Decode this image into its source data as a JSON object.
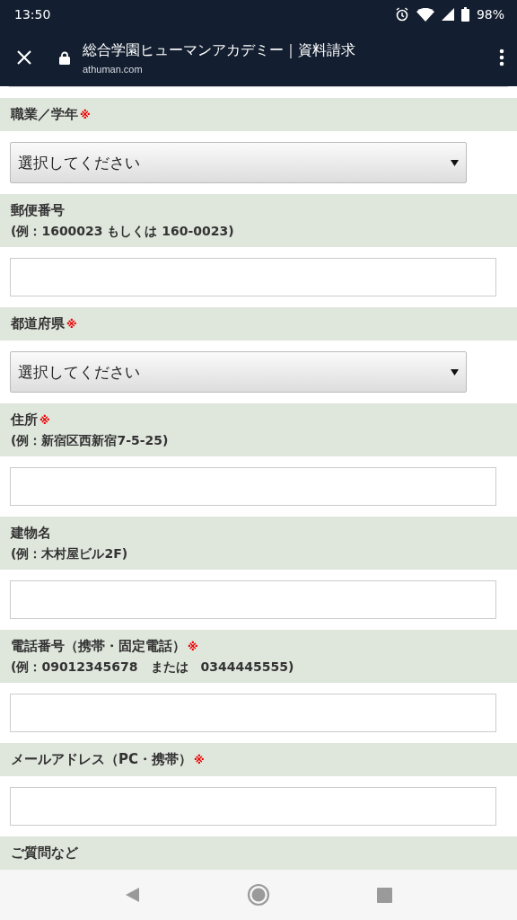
{
  "status_bar": {
    "time": "13:50",
    "battery": "98%"
  },
  "toolbar": {
    "title": "総合学園ヒューマンアカデミー｜資料請求",
    "url": "athuman.com"
  },
  "fields": [
    {
      "label": "職業／学年",
      "required_mark": "※",
      "kind": "select",
      "value": "選択してください"
    },
    {
      "label": "郵便番号",
      "hint": "(例：1600023 もしくは 160-0023)",
      "kind": "text"
    },
    {
      "label": "都道府県",
      "required_mark": "※",
      "kind": "select",
      "value": "選択してください"
    },
    {
      "label": "住所",
      "required_mark": "※",
      "hint": "(例：新宿区西新宿7-5-25)",
      "kind": "text"
    },
    {
      "label": "建物名",
      "hint": "(例：木村屋ビル2F)",
      "kind": "text"
    },
    {
      "label": "電話番号（携帯・固定電話）",
      "required_mark": "※",
      "hint": "(例：09012345678　または　0344445555)",
      "kind": "text"
    },
    {
      "label": "メールアドレス（PC・携帯）",
      "required_mark": "※",
      "kind": "text"
    },
    {
      "label": "ご質問など",
      "kind": "none"
    }
  ]
}
